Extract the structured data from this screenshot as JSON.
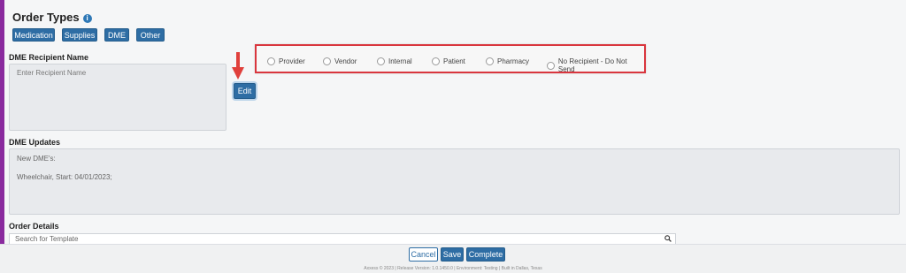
{
  "page": {
    "title": "Order Types",
    "info_icon": "i"
  },
  "order_types": [
    "Medication",
    "Supplies",
    "DME",
    "Other"
  ],
  "recipient": {
    "label": "DME Recipient Name",
    "placeholder": "Enter Recipient Name",
    "edit_label": "Edit",
    "options": [
      "Provider",
      "Vendor",
      "Internal",
      "Patient",
      "Pharmacy",
      "No Recipient - Do Not Send"
    ]
  },
  "updates": {
    "label": "DME Updates",
    "line1": "New DME's:",
    "line2": "Wheelchair, Start: 04/01/2023;"
  },
  "order_details": {
    "label": "Order Details",
    "search_placeholder": "Search for Template"
  },
  "footer": {
    "cancel_label": "Cancel",
    "save_label": "Save",
    "complete_label": "Complete",
    "credit": "Axxess © 2023 | Release Version: 1.0.1450.0 | Environment: Testing | Built in Dallas, Texas"
  },
  "colors": {
    "accent": "#2e6da4",
    "highlight": "#d9363e",
    "sidebar": "#8a2a9e"
  }
}
